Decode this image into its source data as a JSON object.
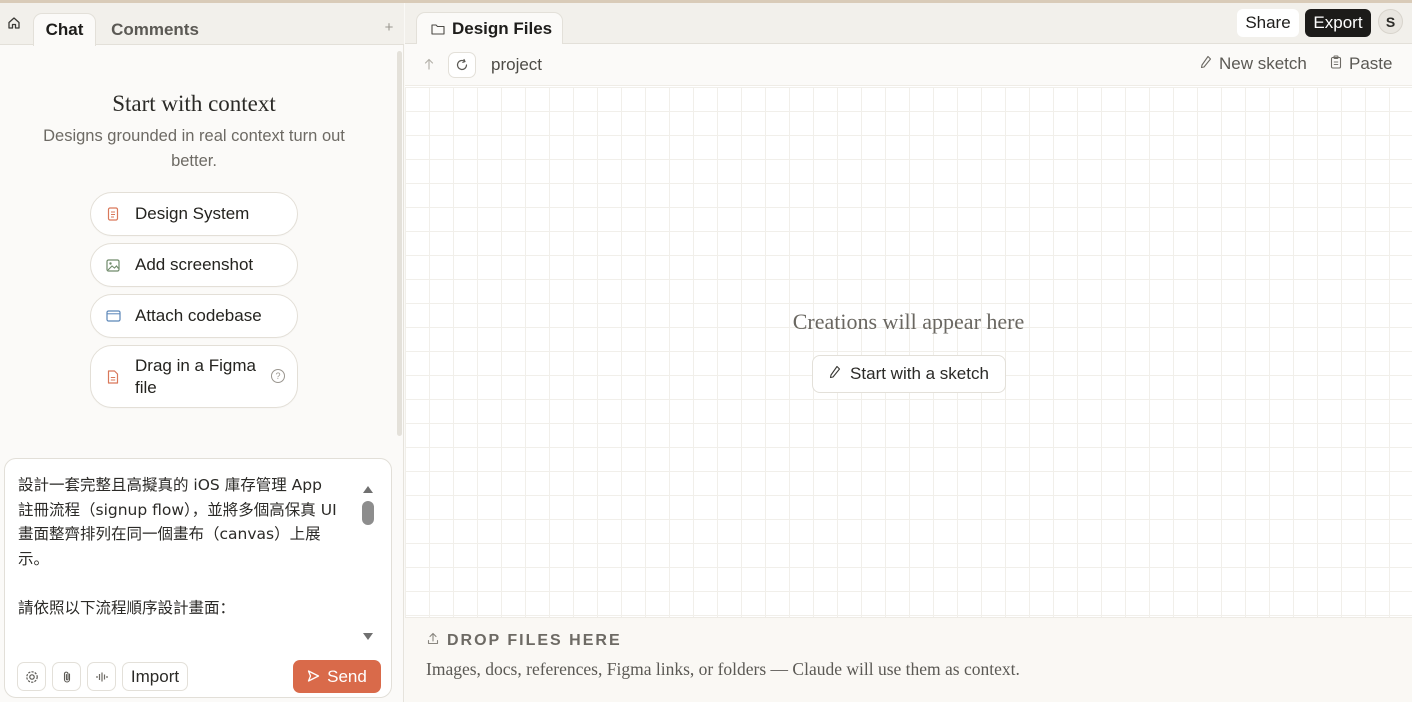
{
  "left_panel": {
    "tabs": {
      "chat": "Chat",
      "comments": "Comments",
      "add": "+"
    },
    "context": {
      "title": "Start with context",
      "subtitle": "Designs grounded in real context turn out better.",
      "buttons": [
        {
          "label": "Design System",
          "icon": "document-icon"
        },
        {
          "label": "Add screenshot",
          "icon": "image-icon"
        },
        {
          "label": "Attach codebase",
          "icon": "code-window-icon"
        },
        {
          "label": "Drag in a Figma file",
          "icon": "file-icon"
        }
      ]
    },
    "composer": {
      "text": "設計一套完整且高擬真的 iOS 庫存管理 App\n註冊流程（signup flow），並將多個高保真 UI\n畫面整齊排列在同一個畫布（canvas）上展\n示。\n\n請依照以下流程順序設計畫面：",
      "import_label": "Import",
      "send_label": "Send"
    }
  },
  "right_panel": {
    "tab_label": "Design Files",
    "share_label": "Share",
    "export_label": "Export",
    "avatar_initial": "S",
    "breadcrumb": "project",
    "new_sketch_label": "New sketch",
    "paste_label": "Paste",
    "empty_state": {
      "title": "Creations will appear here",
      "button": "Start with a sketch"
    },
    "drop_zone": {
      "heading": "DROP FILES HERE",
      "subtext": "Images, docs, references, Figma links, or folders — Claude will use them as context."
    }
  },
  "colors": {
    "accent": "#d96a4a",
    "export_bg": "#1c1b19",
    "panel_bg": "#fbfaf8",
    "tab_bar_bg": "#f2f0eb"
  }
}
